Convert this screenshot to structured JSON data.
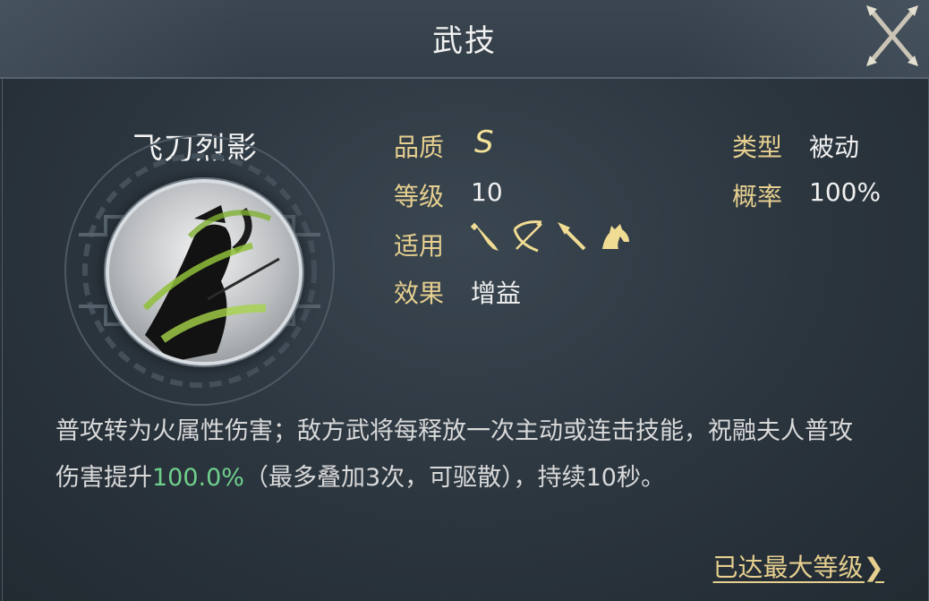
{
  "header": {
    "title": "武技"
  },
  "skill": {
    "name": "飞刀烈影",
    "icon": "skill-portrait-icon"
  },
  "stats": {
    "quality_label": "品质",
    "quality_value": "S",
    "level_label": "等级",
    "level_value": "10",
    "applicable_label": "适用",
    "applicable_icons": [
      "sword-icon",
      "bow-icon",
      "spear-icon",
      "horse-icon"
    ],
    "effect_label": "效果",
    "effect_value": "增益",
    "type_label": "类型",
    "type_value": "被动",
    "chance_label": "概率",
    "chance_value": "100%"
  },
  "description": {
    "part1": "普攻转为火属性伤害；敌方武将每释放一次主动或连击技能，祝融夫人普攻伤害提升",
    "highlight": "100.0%",
    "part2": "（最多叠加3次，可驱散），持续10秒。"
  },
  "footer": {
    "max_level_link": "已达最大等级❯"
  },
  "colors": {
    "gold": "#e6cf8f",
    "highlight_green": "#6fd08c"
  }
}
